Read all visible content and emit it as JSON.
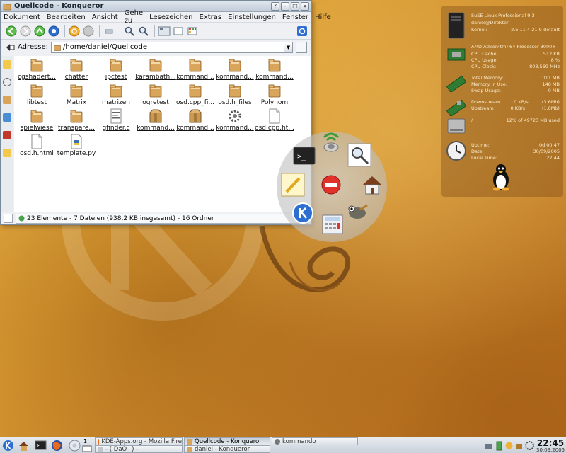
{
  "window": {
    "title": "Quellcode - Konqueror",
    "title_buttons": [
      "?",
      "-",
      "□",
      "x"
    ]
  },
  "menubar": [
    "Dokument",
    "Bearbeiten",
    "Ansicht",
    "Gehe zu",
    "Lesezeichen",
    "Extras",
    "Einstellungen",
    "Fenster",
    "Hilfe"
  ],
  "address": {
    "label": "Adresse:",
    "value": "/home/daniel/Quellcode"
  },
  "files": [
    {
      "name": "cgshadert...",
      "type": "folder"
    },
    {
      "name": "chatter",
      "type": "folder"
    },
    {
      "name": "ipctest",
      "type": "folder"
    },
    {
      "name": "karambath...",
      "type": "folder"
    },
    {
      "name": "kommand...",
      "type": "folder"
    },
    {
      "name": "kommand...",
      "type": "folder"
    },
    {
      "name": "kommand...",
      "type": "folder"
    },
    {
      "name": "libtest",
      "type": "folder"
    },
    {
      "name": "Matrix",
      "type": "folder"
    },
    {
      "name": "matrizen",
      "type": "folder"
    },
    {
      "name": "ogretest",
      "type": "folder"
    },
    {
      "name": "osd.cpp_fi...",
      "type": "folder"
    },
    {
      "name": "osd.h_files",
      "type": "folder"
    },
    {
      "name": "Polynom",
      "type": "folder"
    },
    {
      "name": "spielwiese",
      "type": "folder"
    },
    {
      "name": "transpare...",
      "type": "folder"
    },
    {
      "name": "gfinder.c",
      "type": "c-source"
    },
    {
      "name": "kommand...",
      "type": "package"
    },
    {
      "name": "kommand...",
      "type": "package"
    },
    {
      "name": "kommand...",
      "type": "config"
    },
    {
      "name": "osd.cpp.ht...",
      "type": "document"
    },
    {
      "name": "osd.h.html",
      "type": "document"
    },
    {
      "name": "template.py",
      "type": "python"
    }
  ],
  "status": "23 Elemente - 7 Dateien (938,2 KB insgesamt) - 16 Ordner",
  "sysmon": {
    "os": "SuSE Linux Professional 9.3",
    "user": "daniel@Direkter",
    "kernel_label": "Kernel:",
    "kernel": "2.6.11.4-21.9-default",
    "cpu": "AMD Athlon(tm) 64 Processor 3000+",
    "cpu_cache_label": "CPU Cache:",
    "cpu_cache": "512 KB",
    "cpu_usage_label": "CPU Usage:",
    "cpu_usage": "8 %",
    "cpu_clock_label": "CPU Clock:",
    "cpu_clock": "808.569 MHz",
    "total_mem_label": "Total Memory:",
    "total_mem": "1011 MB",
    "mem_used_label": "Memory In Use:",
    "mem_used": "148 MB",
    "swap_label": "Swap Usage:",
    "swap": "0 MB",
    "down_label": "Downstream",
    "down": "0 KB/s",
    "down_total": "(3.6Mb)",
    "up_label": "Upstream",
    "up": "0 KB/s",
    "up_total": "(1.0Mb)",
    "disk_label": "/",
    "disk": "12% of 49723 MB used",
    "uptime_label": "Uptime:",
    "uptime": "0d 00:47",
    "date_label": "Date:",
    "date": "30/09/2005",
    "localtime_label": "Local Time:",
    "localtime": "22:44"
  },
  "taskbar": {
    "desktop_number": "1",
    "tasks": [
      {
        "label": "KDE-Apps.org - Mozilla Fire",
        "active": false
      },
      {
        "label": "Quellcode - Konqueror",
        "active": true
      },
      {
        "label": "kommando",
        "active": false
      },
      {
        "label": "- ( DaO_ ) -",
        "active": false
      },
      {
        "label": "daniel - Konqueror",
        "active": false
      }
    ],
    "time": "22:45",
    "date": "30.09.2005"
  },
  "colors": {
    "folder": "#d9a55a",
    "accent_blue": "#2f6fd0",
    "panel_bg": "#d5dce4"
  }
}
